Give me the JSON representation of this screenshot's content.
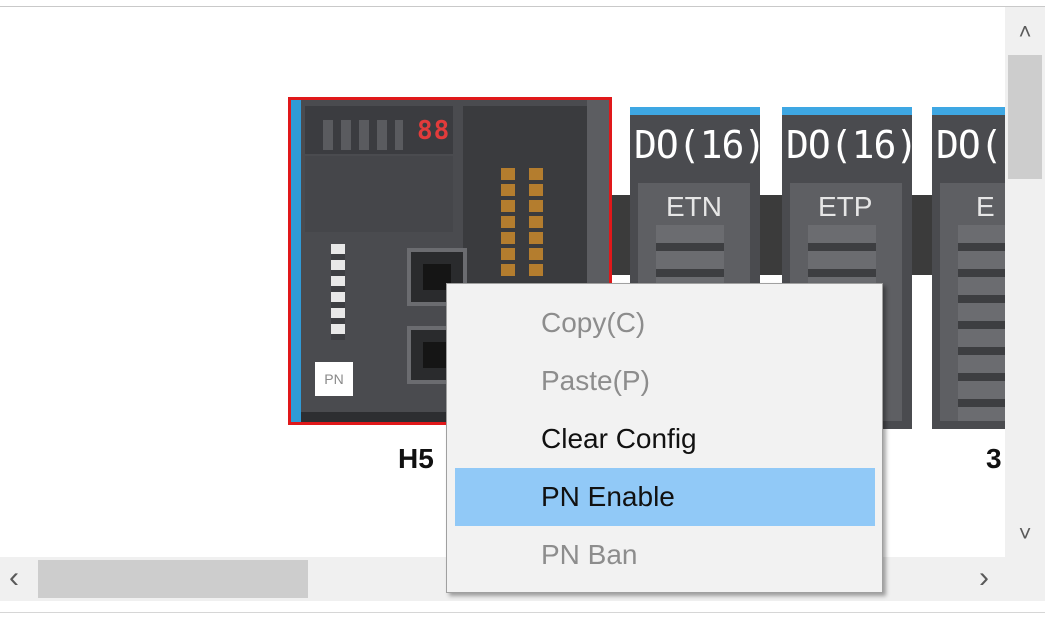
{
  "canvas": {
    "modules": [
      {
        "kind": "cpu",
        "badge": "PN",
        "name": "H5",
        "display_digits": "88"
      },
      {
        "kind": "io",
        "label": "DO(16)",
        "tag": "ETN",
        "name": ""
      },
      {
        "kind": "io",
        "label": "DO(16)",
        "tag": "ETP",
        "name": ""
      },
      {
        "kind": "io",
        "label": "DO(",
        "tag": "E",
        "name": "3"
      }
    ]
  },
  "context_menu": {
    "items": [
      {
        "label": "Copy(C)",
        "enabled": false,
        "highlighted": false
      },
      {
        "label": "Paste(P)",
        "enabled": false,
        "highlighted": false
      },
      {
        "label": "Clear Config",
        "enabled": true,
        "highlighted": false
      },
      {
        "label": "PN Enable",
        "enabled": true,
        "highlighted": true
      },
      {
        "label": "PN Ban",
        "enabled": false,
        "highlighted": false
      }
    ]
  },
  "scrollbars": {
    "vertical": {
      "up_icon": "chevron-up-icon",
      "down_icon": "chevron-down-icon",
      "up_glyph": "˄",
      "down_glyph": "˅"
    },
    "horizontal": {
      "left_icon": "chevron-left-icon",
      "right_icon": "chevron-right-icon",
      "left_glyph": "‹",
      "right_glyph": "›"
    }
  },
  "colors": {
    "selection_border": "#e0181a",
    "menu_highlight": "#91c9f7",
    "module_cap": "#3ea7e3"
  }
}
